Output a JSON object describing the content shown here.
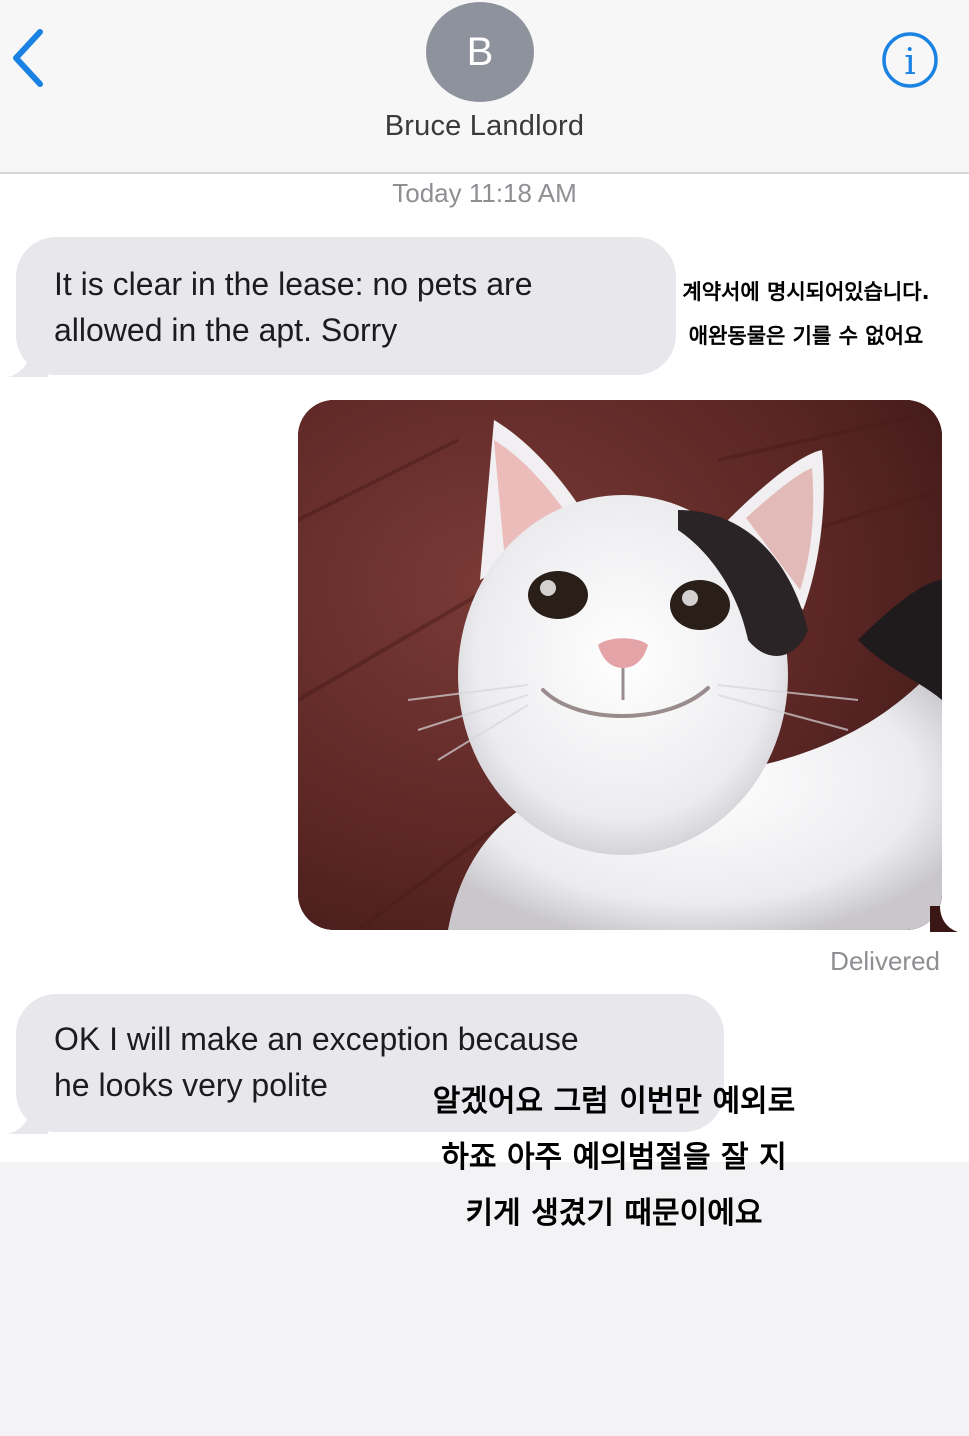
{
  "header": {
    "avatar_initial": "B",
    "contact_name": "Bruce Landlord"
  },
  "thread": {
    "timestamp": "Today 11:18 AM",
    "messages": [
      {
        "direction": "incoming",
        "lines": [
          "It is clear in the lease: no pets are",
          "allowed in the apt. Sorry"
        ],
        "overlay_lines": [
          "계약서에 명시되어있습니다.",
          "애완동물은 기를 수 없어요"
        ]
      },
      {
        "direction": "outgoing",
        "type": "photo",
        "status": "Delivered"
      },
      {
        "direction": "incoming",
        "lines": [
          "OK I will make an exception because",
          "he looks very polite"
        ],
        "overlay_lines": [
          "알겠어요 그럼 이번만 예외로",
          "하죠 아주 예의범절을 잘 지",
          "키게 생겼기 때문이에요"
        ]
      }
    ]
  },
  "colors": {
    "accent": "#1a82e2",
    "incoming_bubble": "#e8e8ec",
    "secondary_text": "#8e8e93",
    "avatar": "#8e929d"
  },
  "icons": {
    "back": "chevron-left-icon",
    "info": "info-circle-icon"
  }
}
